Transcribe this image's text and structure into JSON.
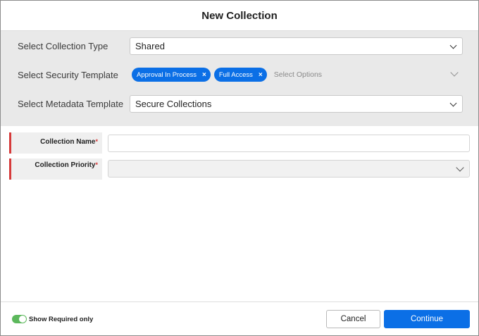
{
  "dialog": {
    "title": "New Collection"
  },
  "collection_type": {
    "label": "Select Collection Type",
    "value": "Shared"
  },
  "security_template": {
    "label": "Select Security Template",
    "selected": [
      "Approval In Process",
      "Full Access"
    ],
    "remove_glyph": "×",
    "placeholder": "Select Options"
  },
  "metadata_template": {
    "label": "Select Metadata Template",
    "value": "Secure Collections"
  },
  "form": {
    "collection_name": {
      "label": "Collection Name",
      "required_mark": "*",
      "value": ""
    },
    "collection_priority": {
      "label": "Collection Priority",
      "required_mark": "*",
      "value": ""
    }
  },
  "footer": {
    "toggle_label": "Show Required only",
    "toggle_on": true,
    "toggle_color": "#5cb85c",
    "cancel_label": "Cancel",
    "continue_label": "Continue"
  },
  "colors": {
    "accent": "#0b6fe6",
    "required": "#d63a3a",
    "panel_bg": "#e9e9e9"
  }
}
